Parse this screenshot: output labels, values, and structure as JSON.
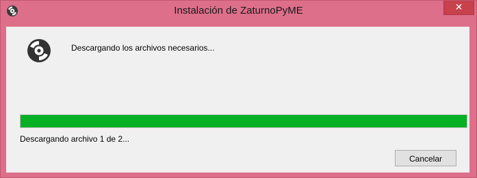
{
  "window": {
    "title": "Instalación de ZaturnoPyME",
    "close_label": "✕",
    "title_icon": "disc-icon"
  },
  "content": {
    "icon": "disc-icon",
    "status_message": "Descargando los archivos necesarios...",
    "progress_fraction": 1.0,
    "progress_color": "#06b025",
    "detail_message": "Descargando archivo 1 de 2...",
    "cancel_label": "Cancelar"
  },
  "colors": {
    "titlebar": "#dd6f8a",
    "close_button": "#c7424d",
    "client_background": "#f0f0f0"
  }
}
